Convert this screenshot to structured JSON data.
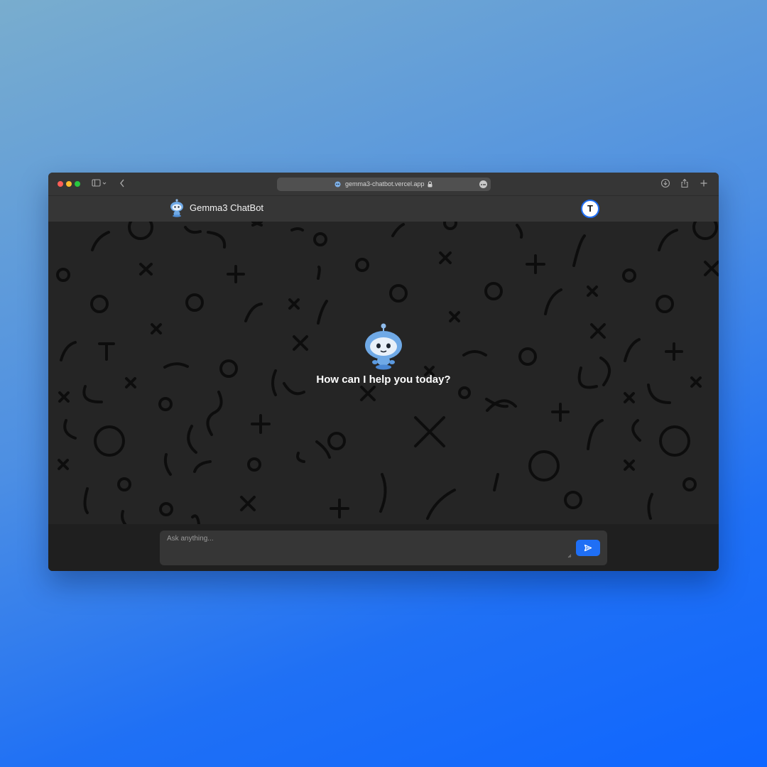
{
  "browser": {
    "url": "gemma3-chatbot.vercel.app"
  },
  "header": {
    "brand_title": "Gemma3 ChatBot",
    "avatar_initial": "T"
  },
  "main": {
    "welcome_text": "How can I help you today?"
  },
  "composer": {
    "placeholder": "Ask anything..."
  },
  "icons": {
    "send": "send-icon",
    "sidebar": "sidebar-toggle-icon",
    "back": "chevron-left-icon",
    "download": "download-icon",
    "share": "share-icon",
    "new_tab": "plus-icon",
    "lock": "lock-icon",
    "more": "more-icon"
  },
  "colors": {
    "accent": "#1f6ff5",
    "background": "#252525",
    "header": "#363636"
  }
}
